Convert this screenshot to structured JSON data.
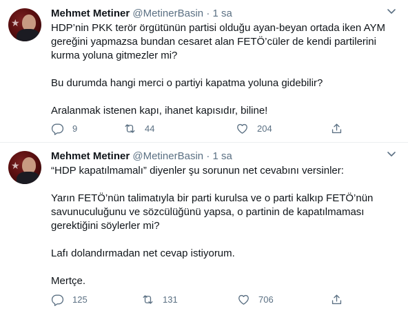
{
  "tweets": [
    {
      "display_name": "Mehmet Metiner",
      "handle": "@MetinerBasin",
      "separator": "·",
      "time": "1 sa",
      "paragraphs": [
        "HDP’nin PKK terör örgütünün partisi olduğu ayan-beyan ortada iken AYM\ngereğini yapmazsa bundan cesaret alan FETÖ’cüler de kendi partilerini\nkurma yoluna gitmezler mi?",
        "Bu durumda hangi merci o partiyi kapatma yoluna gidebilir?",
        "Aralanmak istenen kapı, ihanet kapısıdır, biline!"
      ],
      "replies": "9",
      "retweets": "44",
      "likes": "204"
    },
    {
      "display_name": "Mehmet Metiner",
      "handle": "@MetinerBasin",
      "separator": "·",
      "time": "1 sa",
      "paragraphs": [
        "“HDP kapatılmamalı” diyenler şu sorunun net cevabını versinler:",
        "Yarın FETÖ’nün talimatıyla bir parti kurulsa ve o parti kalkıp FETÖ’nün\nsavunuculuğunu ve sözcülüğünü yapsa, o partinin de kapatılmaması\ngerektiğini söylerler mi?",
        "Lafı dolandırmadan net cevap istiyorum.",
        "Mertçe."
      ],
      "replies": "125",
      "retweets": "131",
      "likes": "706"
    }
  ],
  "icons": {
    "more": "chevron-down-icon",
    "reply": "reply-icon",
    "retweet": "retweet-icon",
    "like": "heart-icon",
    "share": "share-icon"
  },
  "colors": {
    "text": "#0f1419",
    "secondary": "#5b7083",
    "divider": "#ebeef0"
  }
}
